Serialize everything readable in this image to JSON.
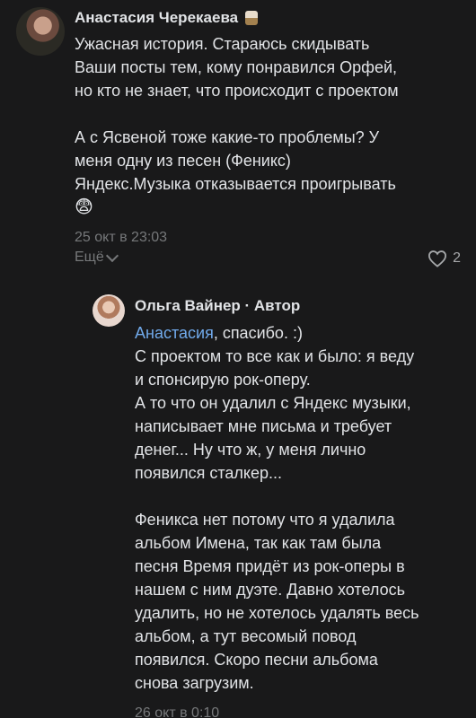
{
  "comment": {
    "author": "Анастасия Черекаева",
    "paragraph1": "Ужасная история. Стараюсь скидывать\nВаши посты тем, кому понравился Орфей,\nно кто не знает, что происходит с проектом",
    "paragraph2": "А с Ясвеной тоже какие-то проблемы? У\nменя одну из песен (Феникс)\nЯндекс.Музыка отказывается проигрывать",
    "emoji": "😨",
    "date": "25 окт в 23:03",
    "more_label": "Ещё",
    "likes": "2"
  },
  "reply": {
    "author": "Ольга Вайнер",
    "separator": " · ",
    "role": "Автор",
    "mention": "Анастасия",
    "mention_tail": ", спасибо. :)",
    "paragraph1": "С проектом то все как и было: я веду\nи спонсирую рок-оперу.\nА то что он удалил с Яндекс музыки,\nнаписывает мне письма и требует\nденег... Ну что ж, у меня лично\nпоявился сталкер...",
    "paragraph2": "Феникса нет потому что я удалила\nальбом Имена, так как там была\nпесня Время придёт из рок-оперы в\nнашем с ним дуэте. Давно хотелось\nудалить, но не хотелось удалять весь\nальбом, а тут весомый повод\nпоявился. Скоро песни альбома\nснова загрузим.",
    "date": "26 окт в 0:10"
  },
  "colors": {
    "background": "#19191a",
    "text": "#e1e3e6",
    "secondary": "#76787a",
    "link": "#71aaeb"
  }
}
